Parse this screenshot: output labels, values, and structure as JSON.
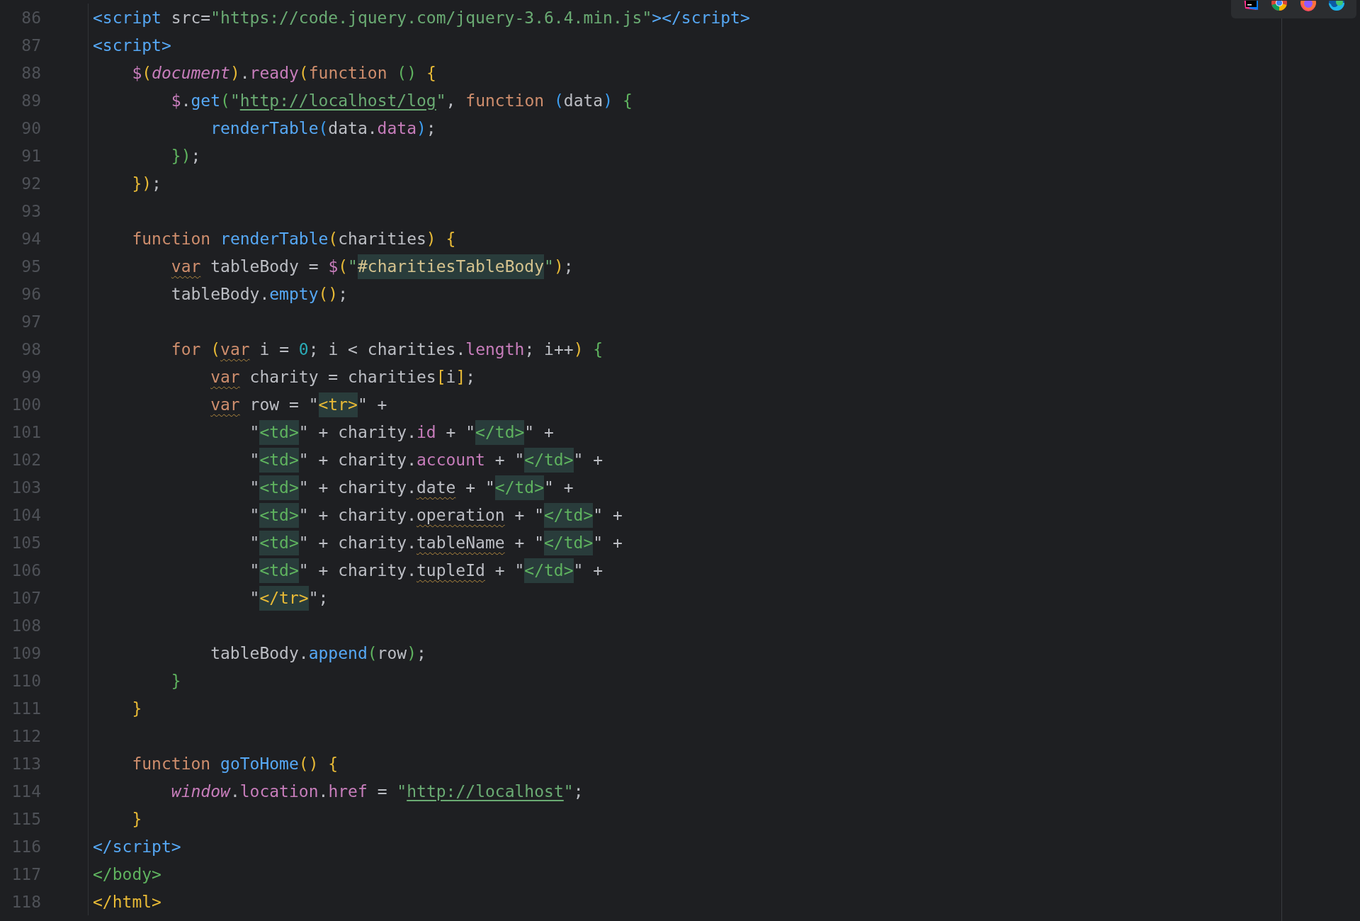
{
  "toolbar": {
    "icons": [
      {
        "kind": "ide"
      },
      {
        "kind": "chrome"
      },
      {
        "kind": "firefox"
      },
      {
        "kind": "edge"
      }
    ]
  },
  "lines": [
    {
      "number": "86",
      "tokens": [
        {
          "kind": "tag",
          "text": "<script"
        },
        {
          "kind": "plain",
          "text": " src="
        },
        {
          "kind": "str",
          "text": "\"https://code.jquery.com/jquery-3.6.4.min.js\""
        },
        {
          "kind": "tag",
          "text": "></script>"
        }
      ]
    },
    {
      "number": "87",
      "tokens": [
        {
          "kind": "tag",
          "text": "<script>"
        }
      ]
    },
    {
      "number": "88",
      "tokens": [
        {
          "kind": "prop",
          "text": "    $"
        },
        {
          "kind": "by",
          "text": "("
        },
        {
          "kind": "glob",
          "text": "document"
        },
        {
          "kind": "by",
          "text": ")"
        },
        {
          "kind": "plain",
          "text": "."
        },
        {
          "kind": "prop",
          "text": "ready"
        },
        {
          "kind": "by",
          "text": "("
        },
        {
          "kind": "kw",
          "text": "function "
        },
        {
          "kind": "bg",
          "text": "() "
        },
        {
          "kind": "by",
          "text": "{"
        }
      ]
    },
    {
      "number": "89",
      "tokens": [
        {
          "kind": "prop",
          "text": "        $"
        },
        {
          "kind": "plain",
          "text": "."
        },
        {
          "kind": "fn",
          "text": "get"
        },
        {
          "kind": "bg",
          "text": "("
        },
        {
          "kind": "str",
          "text": "\""
        },
        {
          "kind": "url",
          "text": "http://localhost/log"
        },
        {
          "kind": "str",
          "text": "\""
        },
        {
          "kind": "plain",
          "text": ", "
        },
        {
          "kind": "kw",
          "text": "function "
        },
        {
          "kind": "bb",
          "text": "("
        },
        {
          "kind": "plain",
          "text": "data"
        },
        {
          "kind": "bb",
          "text": ") "
        },
        {
          "kind": "bg",
          "text": "{"
        }
      ]
    },
    {
      "number": "90",
      "tokens": [
        {
          "kind": "fn",
          "text": "            renderTable"
        },
        {
          "kind": "bb",
          "text": "("
        },
        {
          "kind": "plain",
          "text": "data."
        },
        {
          "kind": "prop",
          "text": "data"
        },
        {
          "kind": "bb",
          "text": ")"
        },
        {
          "kind": "plain",
          "text": ";"
        }
      ]
    },
    {
      "number": "91",
      "tokens": [
        {
          "kind": "bg",
          "text": "        })"
        },
        {
          "kind": "plain",
          "text": ";"
        }
      ]
    },
    {
      "number": "92",
      "tokens": [
        {
          "kind": "by",
          "text": "    })"
        },
        {
          "kind": "plain",
          "text": ";"
        }
      ]
    },
    {
      "number": "93"
    },
    {
      "number": "94",
      "tokens": [
        {
          "kind": "kw",
          "text": "    function "
        },
        {
          "kind": "fn",
          "text": "renderTable"
        },
        {
          "kind": "by",
          "text": "("
        },
        {
          "kind": "plain",
          "text": "charities"
        },
        {
          "kind": "by",
          "text": ") {"
        }
      ]
    },
    {
      "number": "95",
      "tokens": [
        {
          "kind": "warnkw",
          "text": "        var"
        },
        {
          "kind": "plain",
          "text": " tableBody = "
        },
        {
          "kind": "prop",
          "text": "$"
        },
        {
          "kind": "by",
          "text": "("
        },
        {
          "kind": "str",
          "text": "\""
        },
        {
          "kind": "hlsel",
          "text": "#charitiesTableBody"
        },
        {
          "kind": "str",
          "text": "\""
        },
        {
          "kind": "by",
          "text": ")"
        },
        {
          "kind": "plain",
          "text": ";"
        }
      ]
    },
    {
      "number": "96",
      "tokens": [
        {
          "kind": "plain",
          "text": "        tableBody."
        },
        {
          "kind": "fn",
          "text": "empty"
        },
        {
          "kind": "by",
          "text": "()"
        },
        {
          "kind": "plain",
          "text": ";"
        }
      ]
    },
    {
      "number": "97"
    },
    {
      "number": "98",
      "tokens": [
        {
          "kind": "kw",
          "text": "        for "
        },
        {
          "kind": "by",
          "text": "("
        },
        {
          "kind": "warnkw",
          "text": "var"
        },
        {
          "kind": "plain",
          "text": " i = "
        },
        {
          "kind": "num",
          "text": "0"
        },
        {
          "kind": "plain",
          "text": "; i < charities."
        },
        {
          "kind": "prop",
          "text": "length"
        },
        {
          "kind": "plain",
          "text": "; i++"
        },
        {
          "kind": "by",
          "text": ") "
        },
        {
          "kind": "bg",
          "text": "{"
        }
      ]
    },
    {
      "number": "99",
      "tokens": [
        {
          "kind": "warnkw",
          "text": "            var"
        },
        {
          "kind": "plain",
          "text": " charity = charities"
        },
        {
          "kind": "by",
          "text": "["
        },
        {
          "kind": "plain",
          "text": "i"
        },
        {
          "kind": "by",
          "text": "]"
        },
        {
          "kind": "plain",
          "text": ";"
        }
      ]
    },
    {
      "number": "100",
      "tokens": [
        {
          "kind": "warnkw",
          "text": "            var"
        },
        {
          "kind": "plain",
          "text": " row = \""
        },
        {
          "kind": "hly",
          "text": "<tr>"
        },
        {
          "kind": "plain",
          "text": "\" +"
        }
      ]
    },
    {
      "number": "101",
      "tokens": [
        {
          "kind": "plain",
          "text": "                \""
        },
        {
          "kind": "hlg",
          "text": "<td>"
        },
        {
          "kind": "plain",
          "text": "\" + charity."
        },
        {
          "kind": "prop",
          "text": "id"
        },
        {
          "kind": "plain",
          "text": " + \""
        },
        {
          "kind": "hlg",
          "text": "</td>"
        },
        {
          "kind": "plain",
          "text": "\" +"
        }
      ]
    },
    {
      "number": "102",
      "tokens": [
        {
          "kind": "plain",
          "text": "                \""
        },
        {
          "kind": "hlg",
          "text": "<td>"
        },
        {
          "kind": "plain",
          "text": "\" + charity."
        },
        {
          "kind": "prop",
          "text": "account"
        },
        {
          "kind": "plain",
          "text": " + \""
        },
        {
          "kind": "hlg",
          "text": "</td>"
        },
        {
          "kind": "plain",
          "text": "\" +"
        }
      ]
    },
    {
      "number": "103",
      "tokens": [
        {
          "kind": "plain",
          "text": "                \""
        },
        {
          "kind": "hlg",
          "text": "<td>"
        },
        {
          "kind": "plain",
          "text": "\" + charity."
        },
        {
          "kind": "warn",
          "text": "date"
        },
        {
          "kind": "plain",
          "text": " + \""
        },
        {
          "kind": "hlg",
          "text": "</td>"
        },
        {
          "kind": "plain",
          "text": "\" +"
        }
      ]
    },
    {
      "number": "104",
      "tokens": [
        {
          "kind": "plain",
          "text": "                \""
        },
        {
          "kind": "hlg",
          "text": "<td>"
        },
        {
          "kind": "plain",
          "text": "\" + charity."
        },
        {
          "kind": "warn",
          "text": "operation"
        },
        {
          "kind": "plain",
          "text": " + \""
        },
        {
          "kind": "hlg",
          "text": "</td>"
        },
        {
          "kind": "plain",
          "text": "\" +"
        }
      ]
    },
    {
      "number": "105",
      "tokens": [
        {
          "kind": "plain",
          "text": "                \""
        },
        {
          "kind": "hlg",
          "text": "<td>"
        },
        {
          "kind": "plain",
          "text": "\" + charity."
        },
        {
          "kind": "warn",
          "text": "tableName"
        },
        {
          "kind": "plain",
          "text": " + \""
        },
        {
          "kind": "hlg",
          "text": "</td>"
        },
        {
          "kind": "plain",
          "text": "\" +"
        }
      ]
    },
    {
      "number": "106",
      "tokens": [
        {
          "kind": "plain",
          "text": "                \""
        },
        {
          "kind": "hlg",
          "text": "<td>"
        },
        {
          "kind": "plain",
          "text": "\" + charity."
        },
        {
          "kind": "warn",
          "text": "tupleId"
        },
        {
          "kind": "plain",
          "text": " + \""
        },
        {
          "kind": "hlg",
          "text": "</td>"
        },
        {
          "kind": "plain",
          "text": "\" +"
        }
      ]
    },
    {
      "number": "107",
      "tokens": [
        {
          "kind": "plain",
          "text": "                \""
        },
        {
          "kind": "hly",
          "text": "</tr>"
        },
        {
          "kind": "plain",
          "text": "\";"
        }
      ]
    },
    {
      "number": "108"
    },
    {
      "number": "109",
      "tokens": [
        {
          "kind": "plain",
          "text": "            tableBody."
        },
        {
          "kind": "fn",
          "text": "append"
        },
        {
          "kind": "bg",
          "text": "("
        },
        {
          "kind": "plain",
          "text": "row"
        },
        {
          "kind": "bg",
          "text": ")"
        },
        {
          "kind": "plain",
          "text": ";"
        }
      ]
    },
    {
      "number": "110",
      "tokens": [
        {
          "kind": "bg",
          "text": "        }"
        }
      ]
    },
    {
      "number": "111",
      "tokens": [
        {
          "kind": "by",
          "text": "    }"
        }
      ]
    },
    {
      "number": "112"
    },
    {
      "number": "113",
      "tokens": [
        {
          "kind": "kw",
          "text": "    function "
        },
        {
          "kind": "fn",
          "text": "goToHome"
        },
        {
          "kind": "by",
          "text": "() {"
        }
      ]
    },
    {
      "number": "114",
      "tokens": [
        {
          "kind": "glob",
          "text": "        window"
        },
        {
          "kind": "plain",
          "text": "."
        },
        {
          "kind": "prop",
          "text": "location"
        },
        {
          "kind": "plain",
          "text": "."
        },
        {
          "kind": "prop",
          "text": "href"
        },
        {
          "kind": "plain",
          "text": " = "
        },
        {
          "kind": "str",
          "text": "\""
        },
        {
          "kind": "url",
          "text": "http://localhost"
        },
        {
          "kind": "str",
          "text": "\""
        },
        {
          "kind": "plain",
          "text": ";"
        }
      ]
    },
    {
      "number": "115",
      "tokens": [
        {
          "kind": "by",
          "text": "    }"
        }
      ]
    },
    {
      "number": "116",
      "tokens": [
        {
          "kind": "tag",
          "text": "</script>"
        }
      ]
    },
    {
      "number": "117",
      "tokens": [
        {
          "kind": "tagg",
          "text": "</body>"
        }
      ]
    },
    {
      "number": "118",
      "tokens": [
        {
          "kind": "tagy",
          "text": "</html>"
        }
      ]
    }
  ]
}
